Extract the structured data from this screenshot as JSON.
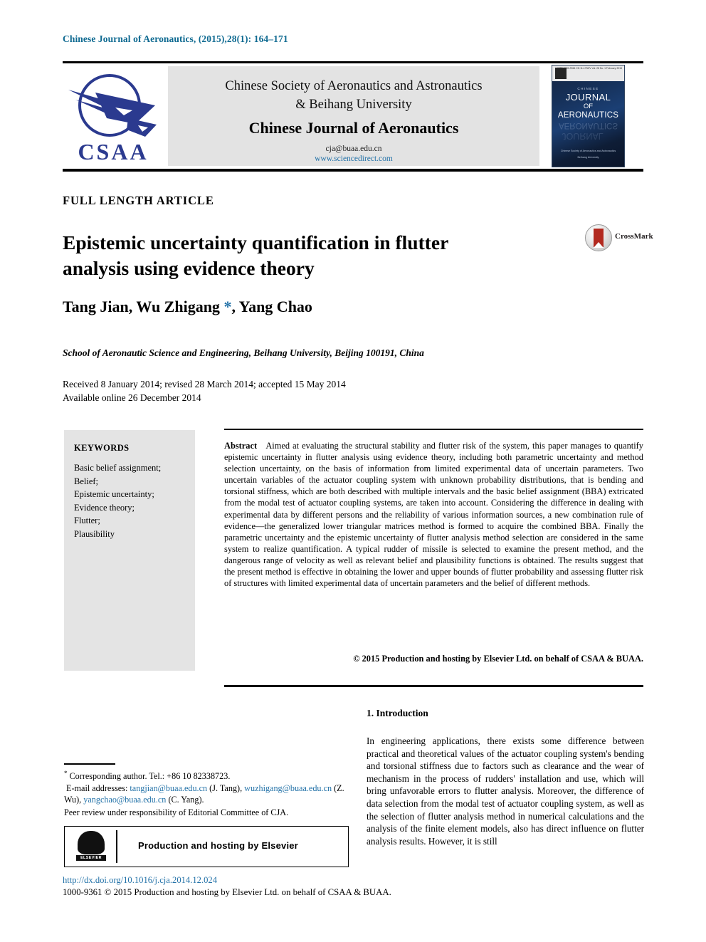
{
  "running_head": "Chinese Journal of Aeronautics, (2015),28(1): 164–171",
  "masthead": {
    "society_line1": "Chinese Society of Aeronautics and Astronautics",
    "society_line2": "& Beihang University",
    "journal_title": "Chinese Journal of Aeronautics",
    "email": "cja@buaa.edu.cn",
    "url": "www.sciencedirect.com",
    "logo_text": "CSAA",
    "cover": {
      "chinese": "CHINESE",
      "word_journal": "JOURNAL",
      "word_of": "OF",
      "word_aeronautics": "AERONAUTICS",
      "issn_block": "ISSN 1000-9361\nCN 11-1732/V\nVol. 28 No. 1 February 2015",
      "society_footer": "Chinese Society of Aeronautics and Astronautics",
      "university_footer": "Beihang University"
    }
  },
  "article": {
    "type": "FULL LENGTH ARTICLE",
    "title_line1": "Epistemic uncertainty quantification in flutter",
    "title_line2": "analysis using evidence theory",
    "crossmark_label": "CrossMark",
    "authors": "Tang Jian, Wu Zhigang ",
    "authors_tail": ", Yang Chao",
    "corresponding_star": "*",
    "affiliation": "School of Aeronautic Science and Engineering, Beihang University, Beijing 100191, China",
    "received": "Received 8 January 2014; revised 28 March 2014; accepted 15 May 2014",
    "available": "Available online 26 December 2014"
  },
  "keywords": {
    "heading": "KEYWORDS",
    "items": [
      "Basic belief assignment;",
      "Belief;",
      "Epistemic uncertainty;",
      "Evidence theory;",
      "Flutter;",
      "Plausibility"
    ]
  },
  "abstract": {
    "label": "Abstract",
    "text": "Aimed at evaluating the structural stability and flutter risk of the system, this paper manages to quantify epistemic uncertainty in flutter analysis using evidence theory, including both parametric uncertainty and method selection uncertainty, on the basis of information from limited experimental data of uncertain parameters. Two uncertain variables of the actuator coupling system with unknown probability distributions, that is bending and torsional stiffness, which are both described with multiple intervals and the basic belief assignment (BBA) extricated from the modal test of actuator coupling systems, are taken into account. Considering the difference in dealing with experimental data by different persons and the reliability of various information sources, a new combination rule of evidence—the generalized lower triangular matrices method is formed to acquire the combined BBA. Finally the parametric uncertainty and the epistemic uncertainty of flutter analysis method selection are considered in the same system to realize quantification. A typical rudder of missile is selected to examine the present method, and the dangerous range of velocity as well as relevant belief and plausibility functions is obtained. The results suggest that the present method is effective in obtaining the lower and upper bounds of flutter probability and assessing flutter risk of structures with limited experimental data of uncertain parameters and the belief of different methods.",
    "copyright": "© 2015 Production and hosting by Elsevier Ltd. on behalf of CSAA & BUAA."
  },
  "introduction": {
    "heading": "1. Introduction",
    "paragraph": "In engineering applications, there exists some difference between practical and theoretical values of the actuator coupling system's bending and torsional stiffness due to factors such as clearance and the wear of mechanism in the process of rudders' installation and use, which will bring unfavorable errors to flutter analysis. Moreover, the difference of data selection from the modal test of actuator coupling system, as well as the selection of flutter analysis method in numerical calculations and the analysis of the finite element models, also has direct influence on flutter analysis results. However, it is still"
  },
  "footnotes": {
    "corresponding": "Corresponding author. Tel.: +86 10 82338723.",
    "email_label": "E-mail addresses:",
    "email1": "tangjian@buaa.edu.cn",
    "email1_name": "(J. Tang),",
    "email2": "wuzhigang@buaa.edu.cn",
    "email2_name": "(Z. Wu),",
    "email3": "yangchao@buaa.edu.cn",
    "email3_name": "(C. Yang).",
    "peer_review": "Peer review under responsibility of Editorial Committee of CJA.",
    "production_box": "Production and hosting by Elsevier",
    "elsevier_wordmark": "ELSEVIER",
    "doi": "http://dx.doi.org/10.1016/j.cja.2014.12.024",
    "issn_line": "1000-9361 © 2015 Production and hosting by Elsevier Ltd. on behalf of CSAA & BUAA."
  },
  "colors": {
    "link": "#2372a8",
    "running_head": "#0f6a91",
    "panel_gray": "#e3e3e3",
    "logo_blue": "#2b3a8f",
    "crossmark_red": "#b2291f"
  }
}
